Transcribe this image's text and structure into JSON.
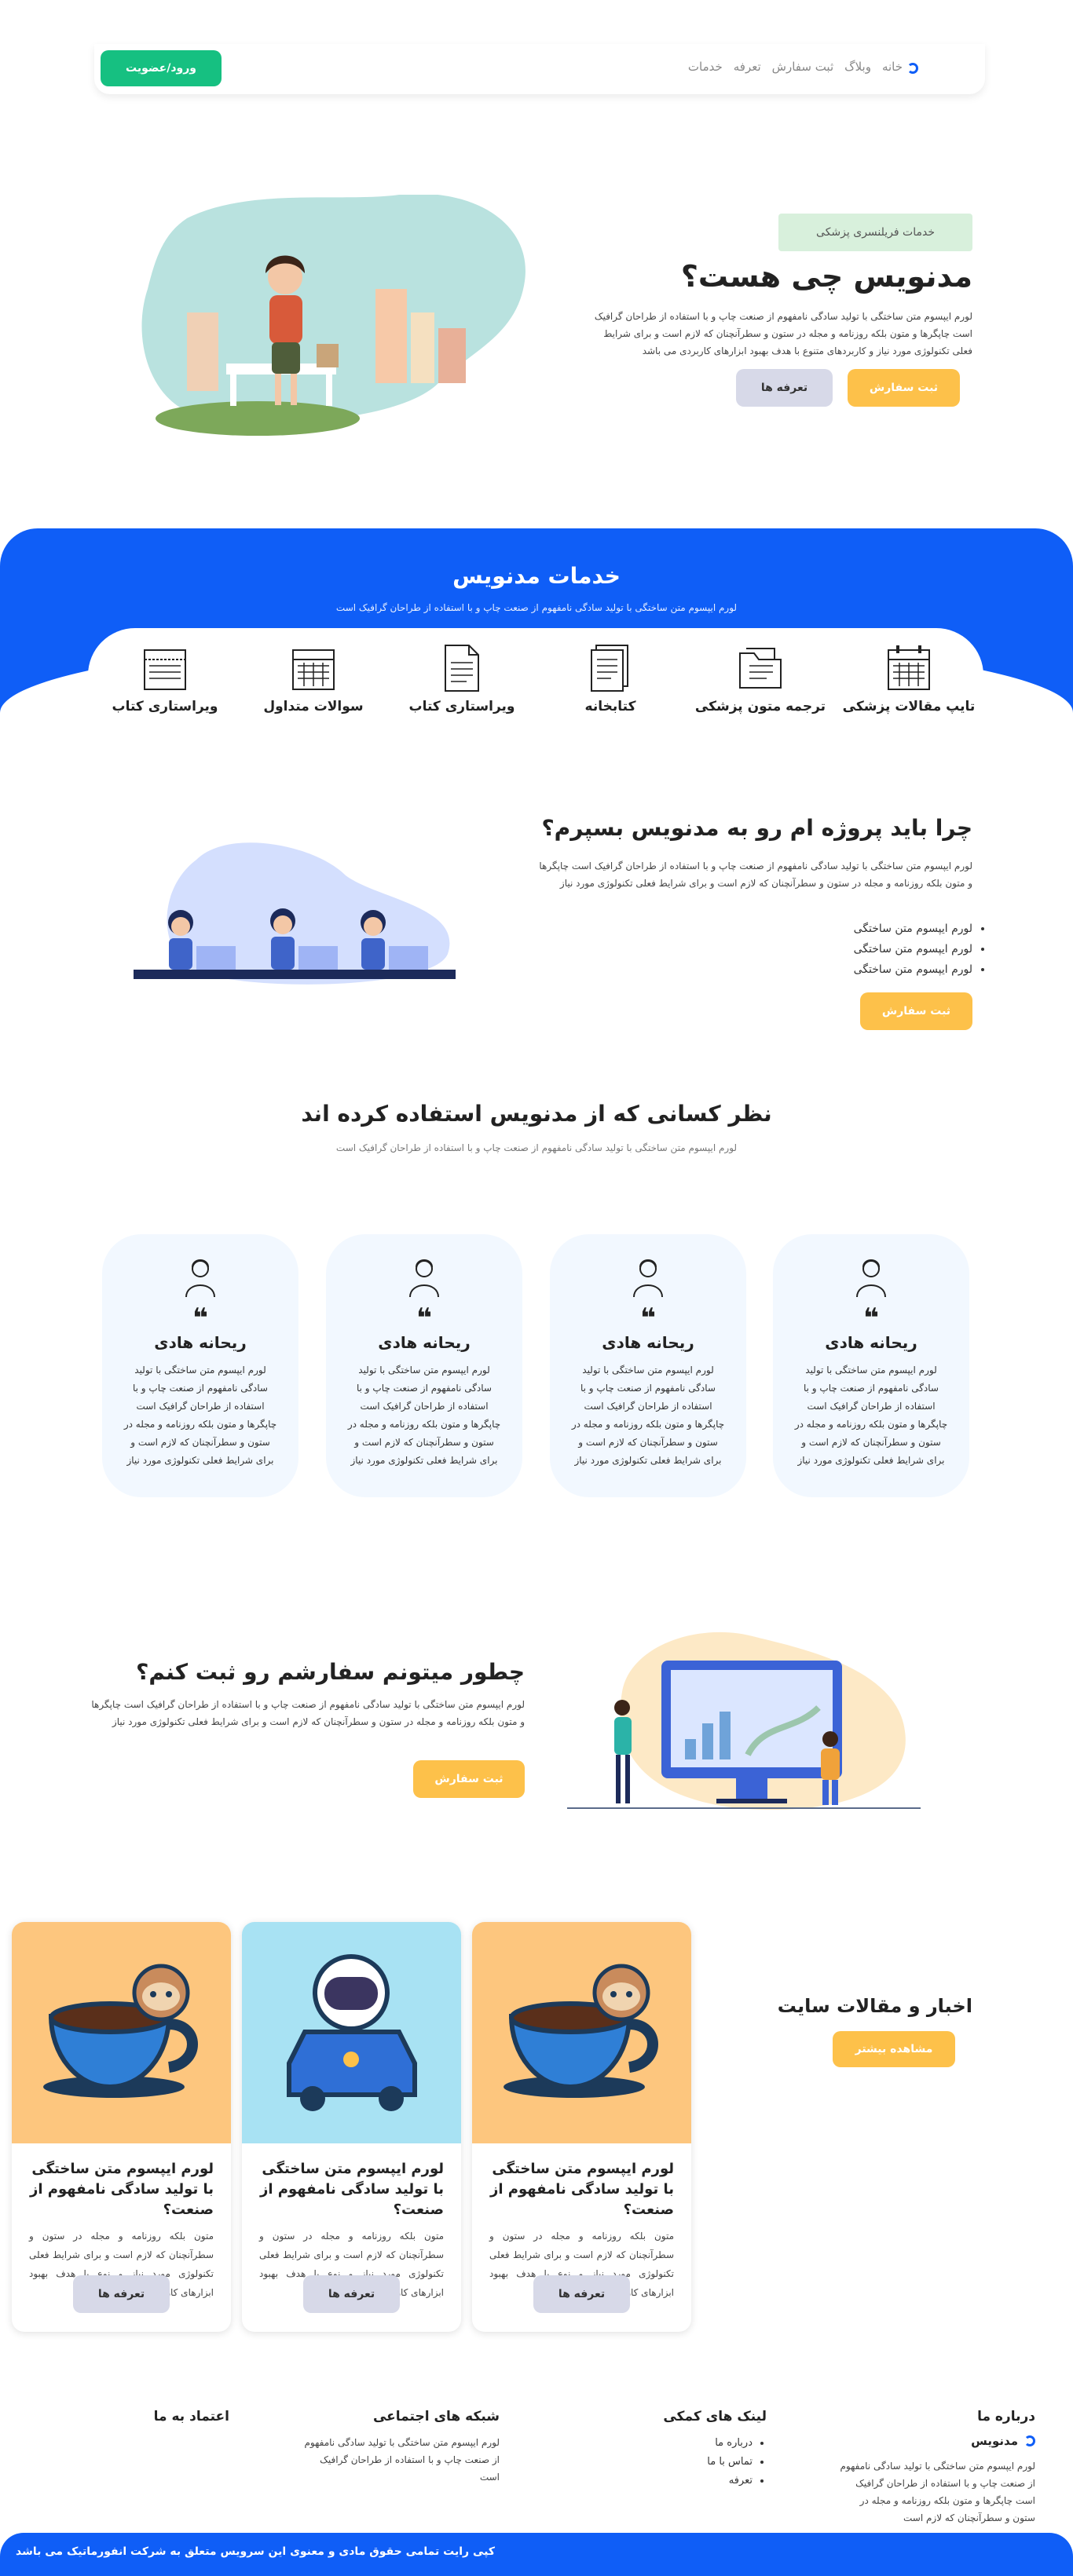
{
  "nav": {
    "links": [
      "خانه",
      "وبلاگ",
      "ثبت سفارش",
      "تعرفه",
      "خدمات"
    ],
    "login": "ورود/عضویت"
  },
  "hero": {
    "tag": "خدمات فریلنسری پزشکی",
    "title": "مدنویس چی هست؟",
    "text": "لورم ایپسوم متن ساختگی با تولید سادگی نامفهوم از صنعت چاپ و با استفاده از طراحان گرافیک است چاپگرها و متون بلکه روزنامه و مجله در ستون و سطرآنچنان که لازم است و برای شرایط فعلی تکنولوژی مورد نیاز و کاربردهای متنوع با هدف بهبود ابزارهای کاربردی می باشد",
    "order": "ثبت سفارش",
    "tariff": "تعرفه ها"
  },
  "services": {
    "title": "خدمات مدنویس",
    "subtitle": "لورم ایپسوم متن ساختگی با تولید سادگی نامفهوم از صنعت چاپ و با استفاده از طراحان گرافیک است",
    "items": [
      "تایپ مقالات پزشکی",
      "ترجمه متون پزشکی",
      "کتابخانه",
      "ویراستاری کتاب",
      "سوالات متداول",
      "ویراستاری کتاب"
    ]
  },
  "why": {
    "title": "چرا باید پروژه ام رو به مدنویس بسپرم؟",
    "text": "لورم ایپسوم متن ساختگی با تولید سادگی نامفهوم از صنعت چاپ و با استفاده از طراحان گرافیک است چاپگرها و متون بلکه روزنامه و مجله در ستون و سطرآنچنان که لازم است و برای شرایط فعلی تکنولوژی مورد نیاز",
    "bullets": [
      "لورم ایپسوم متن ساختگی",
      "لورم ایپسوم متن ساختگی",
      "لورم ایپسوم متن ساختگی"
    ],
    "button": "ثبت سفارش"
  },
  "testimonials": {
    "title": "نظر کسانی که از مدنویس استفاده کرده اند",
    "subtitle": "لورم ایپسوم متن ساختگی با تولید سادگی نامفهوم از صنعت چاپ و با استفاده از طراحان گرافیک است",
    "name": "ریحانه هادی",
    "text": "لورم ایپسوم متن ساختگی با تولید سادگی نامفهوم از صنعت چاپ و با استفاده از طراحان گرافیک است چاپگرها و متون بلکه روزنامه و مجله در ستون و سطرآنچنان که لازم است و برای شرایط فعلی تکنولوژی مورد نیاز"
  },
  "howto": {
    "title": "چطور میتونم سفارشم رو ثبت کنم؟",
    "text": "لورم ایپسوم متن ساختگی با تولید سادگی نامفهوم از صنعت چاپ و با استفاده از طراحان گرافیک است چاپگرها و متون بلکه روزنامه و مجله در ستون و سطرآنچنان که لازم است و برای شرایط فعلی تکنولوژی مورد نیاز",
    "button": "ثبت سفارش"
  },
  "news": {
    "title": "اخبار و مقالات سایت",
    "more": "مشاهده بیشتر",
    "post_title": "لورم ایپسوم متن ساختگی با تولید سادگی نامفهوم از صنعت؟",
    "post_text": "متون بلکه روزنامه و مجله در ستون و سطرآنچنان که لازم است و برای شرایط فعلی تکنولوژی مورد نیاز و نوع با هدف بهبود ابزارهای کاربردی میباشد",
    "button": "تعرفه ها"
  },
  "footer": {
    "about_title": "درباره ما",
    "brand": "مدنویس",
    "about_text": "لورم ایپسوم متن ساختگی با تولید سادگی نامفهوم از صنعت چاپ و با استفاده از طراحان گرافیک است چاپگرها و متون بلکه روزنامه و مجله در ستون و سطرآنچنان که لازم است",
    "links_title": "لینک های کمکی",
    "links": [
      "درباره ما",
      "تماس با ما",
      "تعرفه"
    ],
    "social_title": "شبکه های اجتماعی",
    "social_text": "لورم ایپسوم متن ساختگی با تولید سادگی نامفهوم از صنعت چاپ و با استفاده از طراحان گرافیک است",
    "trust_title": "اعتماد به ما",
    "copyright": "کپی رایت تمامی حقوق مادی و معنوی این سرویس متعلق به شرکت انفورماتیک می باشد"
  },
  "colors": {
    "blue": "#0f5ef7",
    "yellow": "#fdc14a",
    "green": "#16c081"
  }
}
